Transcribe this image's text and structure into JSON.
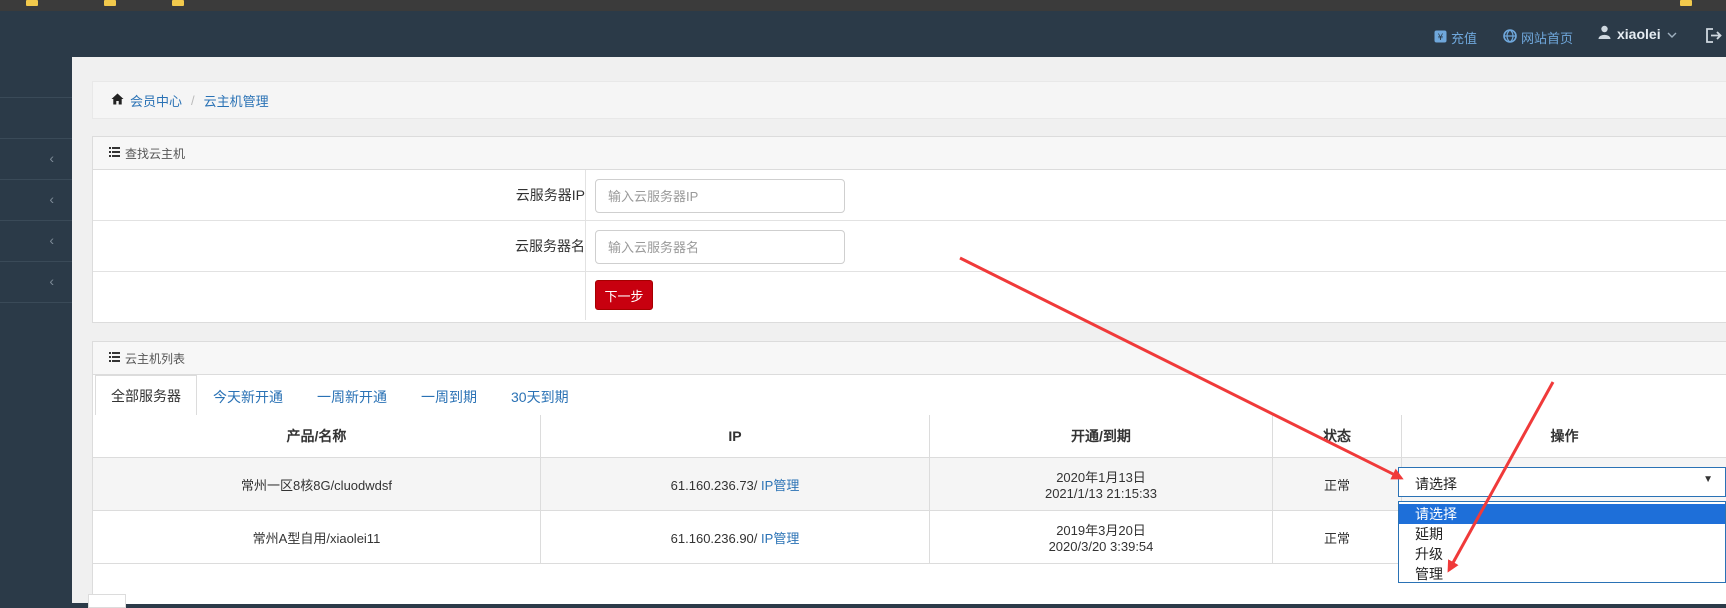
{
  "topbar": {
    "recharge_label": "充值",
    "site_home_label": "网站首页",
    "username": "xiaolei"
  },
  "breadcrumb": {
    "home": "会员中心",
    "separator": "/",
    "current": "云主机管理"
  },
  "search_panel": {
    "title": "查找云主机",
    "ip_label": "云服务器IP",
    "ip_placeholder": "输入云服务器IP",
    "name_label": "云服务器名",
    "name_placeholder": "输入云服务器名",
    "next_button": "下一步"
  },
  "list_panel": {
    "title": "云主机列表",
    "tabs": [
      "全部服务器",
      "今天新开通",
      "一周新开通",
      "一周到期",
      "30天到期"
    ],
    "columns": [
      "产品/名称",
      "IP",
      "开通/到期",
      "状态",
      "操作"
    ],
    "rows": [
      {
        "name": "常州一区8核8G/cluodwdsf",
        "ip": "61.160.236.73/",
        "ip_manage": "IP管理",
        "open_date": "2020年1月13日",
        "expire_date": "2021/1/13 21:15:33",
        "status": "正常"
      },
      {
        "name": "常州A型自用/xiaolei11",
        "ip": "61.160.236.90/",
        "ip_manage": "IP管理",
        "open_date": "2019年3月20日",
        "expire_date": "2020/3/20 3:39:54",
        "status": "正常"
      }
    ]
  },
  "action_select": {
    "value": "请选择",
    "options": [
      "请选择",
      "延期",
      "升级",
      "管理"
    ],
    "highlighted_index": 0
  },
  "colors": {
    "nav_bg": "#2b3a48",
    "link": "#2a72b5",
    "primary_button": "#c8000f",
    "annotation_arrow": "#f03a3a",
    "option_highlight": "#1e6fd9"
  }
}
